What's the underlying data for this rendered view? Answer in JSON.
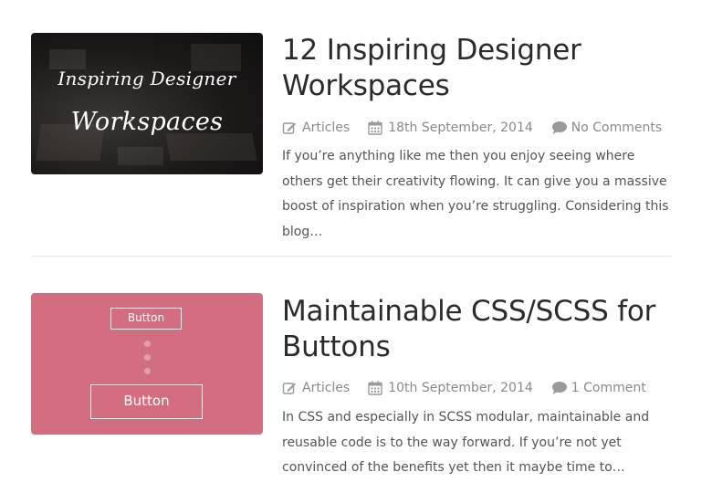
{
  "posts": [
    {
      "thumbnail": {
        "line1": "Inspiring Designer",
        "line2": "Workspaces"
      },
      "title_line1": "12 Inspiring Designer",
      "title_line2": "Workspaces",
      "category": "Articles",
      "date": "18th September, 2014",
      "comments": "No Comments",
      "excerpt": "If you’re anything like me then you enjoy seeing where others get their creativity flowing. It can give you a massive boost of inspiration when you’re struggling. Considering this blog…"
    },
    {
      "thumbnail": {
        "small_button": "Button",
        "large_button": "Button"
      },
      "title_line1": "Maintainable CSS/SCSS for",
      "title_line2": "Buttons",
      "category": "Articles",
      "date": "10th September, 2014",
      "comments": "1 Comment",
      "excerpt": "In CSS and especially in SCSS modular, maintainable and reusable code is to the way forward. If you’re not yet convinced of the benefits yet then it maybe time to…"
    }
  ],
  "icons": {
    "category": "edit-icon",
    "date": "calendar-icon",
    "comments": "comment-icon"
  },
  "colors": {
    "meta_gray": "#8a8a8a",
    "title": "#2b2b2b",
    "thumb_pink": "#d26e80",
    "divider": "#e6e6e6"
  }
}
